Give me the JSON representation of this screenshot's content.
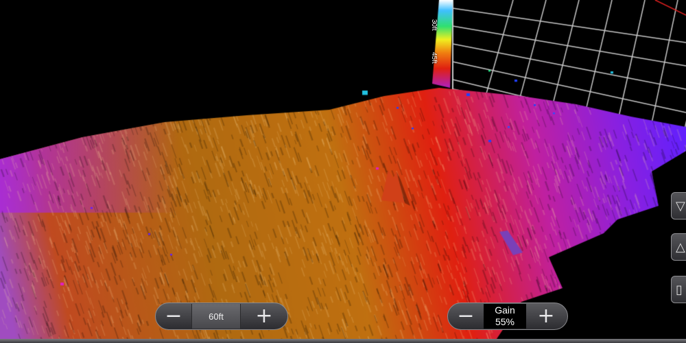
{
  "depth_scale": {
    "ticks": [
      "30ft",
      "45ft"
    ]
  },
  "zoom_control": {
    "minus_symbol": "−",
    "value": "60ft",
    "plus_symbol": "+"
  },
  "gain_control": {
    "minus_symbol": "−",
    "label": "Gain",
    "value": "55%",
    "plus_symbol": "+"
  },
  "side_buttons": [
    {
      "symbol": "▽",
      "icon": "view-down-icon"
    },
    {
      "symbol": "△",
      "icon": "view-up-icon"
    },
    {
      "symbol": "▯",
      "icon": "panel-icon"
    }
  ],
  "colors": {
    "near": "#b06a10",
    "mid": "#e02010",
    "far": "#8a20e0",
    "edge": "#6020ff",
    "grid": "#d0d0d0"
  }
}
